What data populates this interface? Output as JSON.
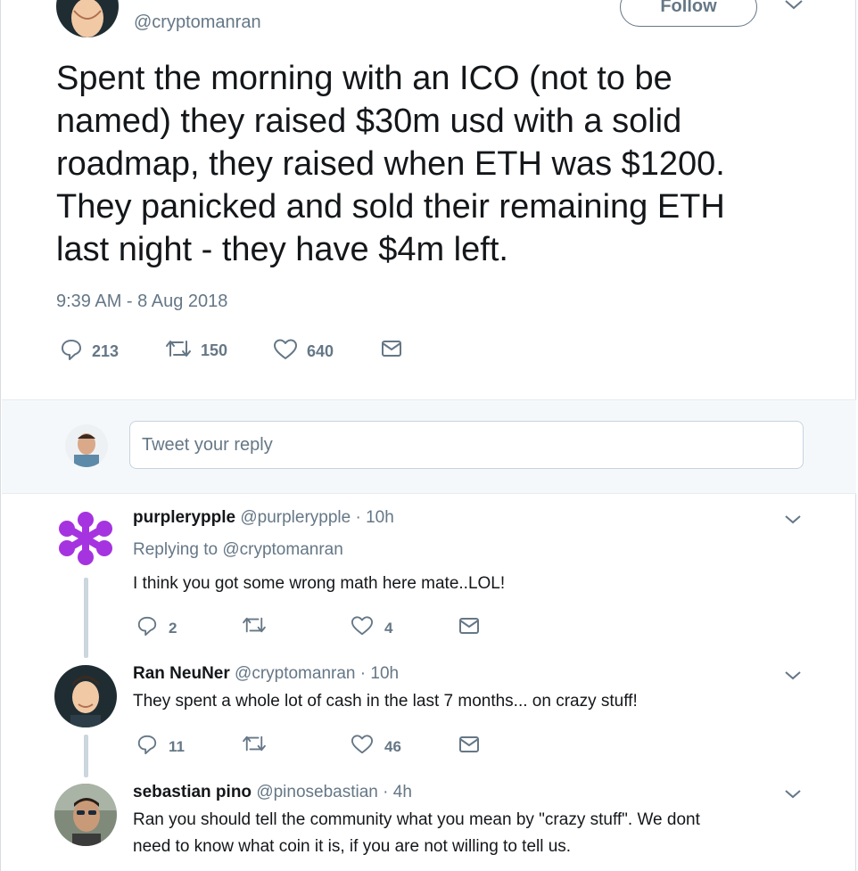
{
  "tweet": {
    "handle": "@cryptomanran",
    "follow_label": "Follow",
    "text": "Spent the morning with an ICO (not to be\nnamed) they raised $30m usd with a solid\nroadmap, they raised when ETH was $1200.\nThey panicked and sold their remaining ETH\nlast night - they have $4m left.",
    "timestamp": "9:39 AM - 8 Aug 2018",
    "replies": "213",
    "retweets": "150",
    "likes": "640"
  },
  "reply_box": {
    "placeholder": "Tweet your reply"
  },
  "comments": [
    {
      "name": "purplerypple",
      "handle": "@purplerypple",
      "time": "· 10h",
      "replying_prefix": "Replying to",
      "replying_to": "@cryptomanran",
      "text": "I think you got some wrong math here mate..LOL!",
      "replies": "2",
      "retweets": "",
      "likes": "4"
    },
    {
      "name": "Ran NeuNer",
      "handle": "@cryptomanran",
      "time": "· 10h",
      "text": "They spent a whole lot of cash in the last 7 months... on crazy stuff!",
      "replies": "11",
      "retweets": "",
      "likes": "46"
    },
    {
      "name": "sebastian pino",
      "handle": "@pinosebastian",
      "time": "· 4h",
      "text_line1": "Ran you should tell the community what you mean by \"crazy stuff\". We dont",
      "text_line2": "need to know what coin it is, if you are not willing to tell us."
    }
  ],
  "colors": {
    "text": "#14171a",
    "muted": "#657786",
    "purple_avatar": "#a633e0",
    "reply_bg": "#f5f8fa"
  }
}
